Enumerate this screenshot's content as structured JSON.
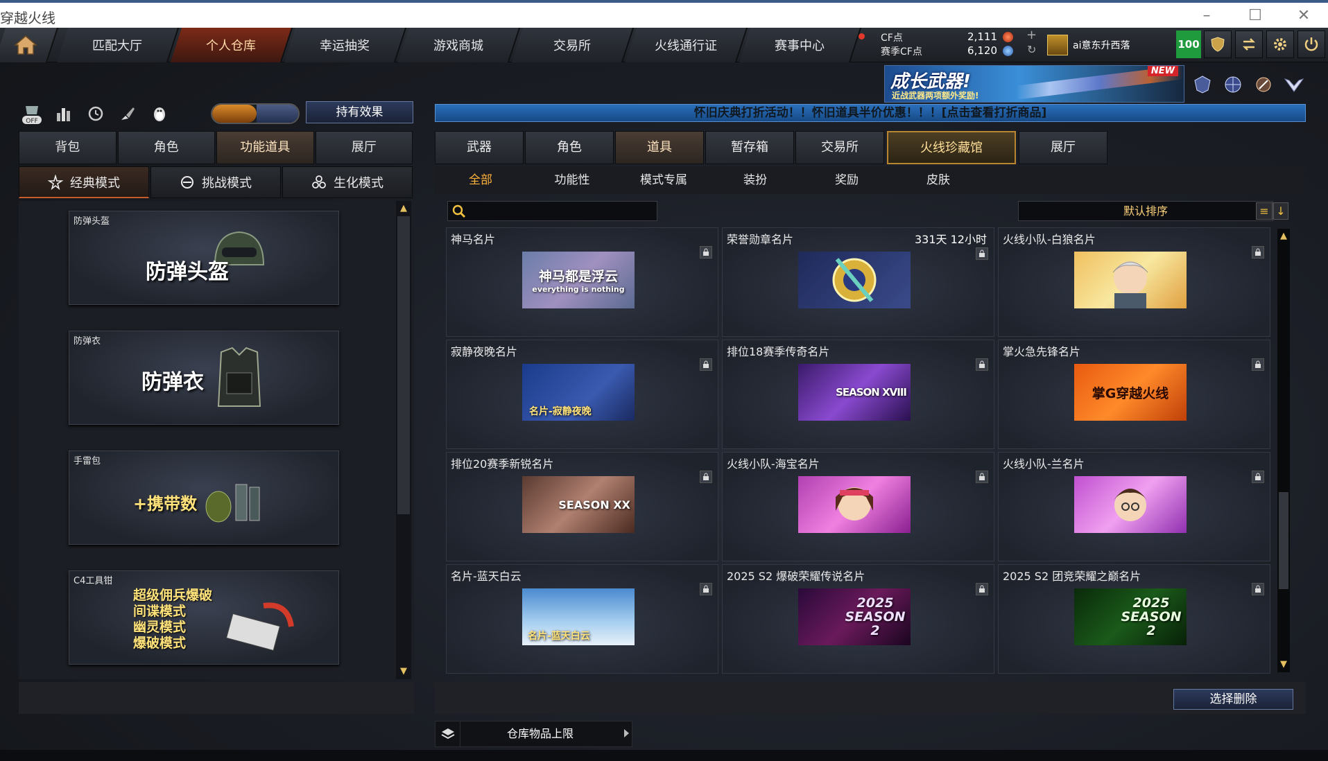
{
  "window": {
    "title": "穿越火线"
  },
  "nav": {
    "tabs": [
      {
        "label": "匹配大厅"
      },
      {
        "label": "个人仓库"
      },
      {
        "label": "幸运抽奖"
      },
      {
        "label": "游戏商城"
      },
      {
        "label": "交易所"
      },
      {
        "label": "火线通行证"
      },
      {
        "label": "赛事中心"
      }
    ],
    "active_index": 1,
    "currency": {
      "cf_label": "CF点",
      "cf_value": "2,111",
      "season_label": "赛季CF点",
      "season_value": "6,120"
    },
    "user_name": "ai意东升西落",
    "level": "100"
  },
  "banner": {
    "title": "成长武器!",
    "subtitle": "近战武器两项额外奖励!",
    "badge": "NEW"
  },
  "notice": "怀旧庆典打折活动！！怀旧道具半价优惠！！！[点击查看打折商品]",
  "left": {
    "toggle_off_label": "OFF",
    "hold_effect_label": "持有效果",
    "tabs": [
      {
        "label": "背包"
      },
      {
        "label": "角色"
      },
      {
        "label": "功能道具"
      },
      {
        "label": "展厅"
      }
    ],
    "active_tab": 2,
    "modes": [
      {
        "label": "经典模式"
      },
      {
        "label": "挑战模式"
      },
      {
        "label": "生化模式"
      }
    ],
    "cards": [
      {
        "caption": "防弹头盔",
        "text": "防弹头盔"
      },
      {
        "caption": "防弹衣",
        "text": "防弹衣"
      },
      {
        "caption": "手雷包",
        "text": "+携带数"
      },
      {
        "caption": "C4工具钳",
        "lines": [
          "超级佣兵爆破",
          "间谍模式",
          "幽灵模式",
          "爆破模式"
        ]
      }
    ]
  },
  "right": {
    "tabs": [
      {
        "label": "武器"
      },
      {
        "label": "角色"
      },
      {
        "label": "道具"
      },
      {
        "label": "暂存箱"
      },
      {
        "label": "交易所"
      },
      {
        "label": "火线珍藏馆"
      },
      {
        "label": "展厅"
      }
    ],
    "active_tab": 2,
    "subtabs": [
      {
        "label": "全部"
      },
      {
        "label": "功能性"
      },
      {
        "label": "模式专属"
      },
      {
        "label": "装扮"
      },
      {
        "label": "奖励"
      },
      {
        "label": "皮肤"
      }
    ],
    "search": {
      "placeholder": ""
    },
    "sort_label": "默认排序",
    "items": [
      {
        "name": "神马名片",
        "time": "",
        "img_text": "神马都是浮云",
        "img_sub": "everything is nothing"
      },
      {
        "name": "荣誉勋章名片",
        "time": "331天 12小时",
        "img_text": "",
        "img_sub": ""
      },
      {
        "name": "火线小队-白狼名片",
        "time": "",
        "img_text": "",
        "img_sub": ""
      },
      {
        "name": "寂静夜晚名片",
        "time": "",
        "img_text": "名片-寂静夜晚",
        "img_sub": ""
      },
      {
        "name": "排位18赛季传奇名片",
        "time": "",
        "img_text": "SEASON XVIII",
        "img_sub": ""
      },
      {
        "name": "掌火急先锋名片",
        "time": "",
        "img_text": "掌G穿越火线",
        "img_sub": ""
      },
      {
        "name": "排位20赛季新锐名片",
        "time": "",
        "img_text": "SEASON XX",
        "img_sub": ""
      },
      {
        "name": "火线小队-海宝名片",
        "time": "",
        "img_text": "",
        "img_sub": ""
      },
      {
        "name": "火线小队-兰名片",
        "time": "",
        "img_text": "",
        "img_sub": ""
      },
      {
        "name": "名片-蓝天白云",
        "time": "",
        "img_text": "名片-蓝天白云",
        "img_sub": ""
      },
      {
        "name": "2025 S2 爆破荣耀传说名片",
        "time": "",
        "img_text": "2025 SEASON 2",
        "img_sub": ""
      },
      {
        "name": "2025 S2 团竞荣耀之巅名片",
        "time": "",
        "img_text": "2025 SEASON 2",
        "img_sub": ""
      }
    ],
    "delete_label": "选择删除",
    "capacity_label": "仓库物品上限"
  }
}
